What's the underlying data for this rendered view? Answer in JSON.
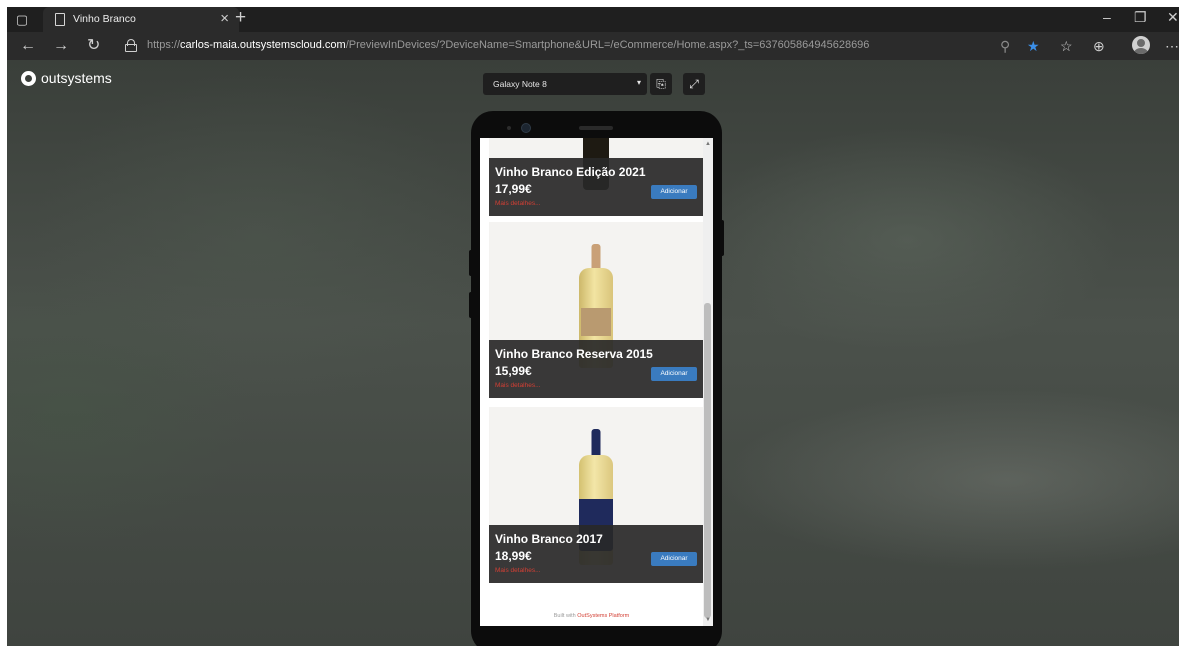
{
  "browser": {
    "tab": {
      "title": "Vinho Branco"
    },
    "url": {
      "protocol": "https://",
      "host": "carlos-maia.outsystemscloud.com",
      "path": "/PreviewInDevices/?DeviceName=Smartphone&URL=/eCommerce/Home.aspx?_ts=637605864945628696"
    }
  },
  "preview": {
    "brand": "outsystems",
    "device_name": "Galaxy Note 8"
  },
  "products": [
    {
      "name": "Vinho Branco Edição 2021",
      "price": "17,99€",
      "details_link": "Mais detalhes...",
      "add_label": "Adicionar",
      "neck_color": "#2a2418",
      "body_color": "#1e1a12"
    },
    {
      "name": "Vinho Branco Reserva 2015",
      "price": "15,99€",
      "details_link": "Mais detalhes...",
      "add_label": "Adicionar",
      "neck_color": "#c9a077",
      "body_color": "#e7d589"
    },
    {
      "name": "Vinho Branco 2017",
      "price": "18,99€",
      "details_link": "Mais detalhes...",
      "add_label": "Adicionar",
      "neck_color": "#1f2a5c",
      "body_color": "#e9da8c"
    }
  ],
  "footer": {
    "prefix": "Built with ",
    "link": "OutSystems Platform"
  },
  "colors": {
    "accent": "#3a7bbf",
    "link": "#d33f34",
    "star": "#3b8fe8"
  }
}
